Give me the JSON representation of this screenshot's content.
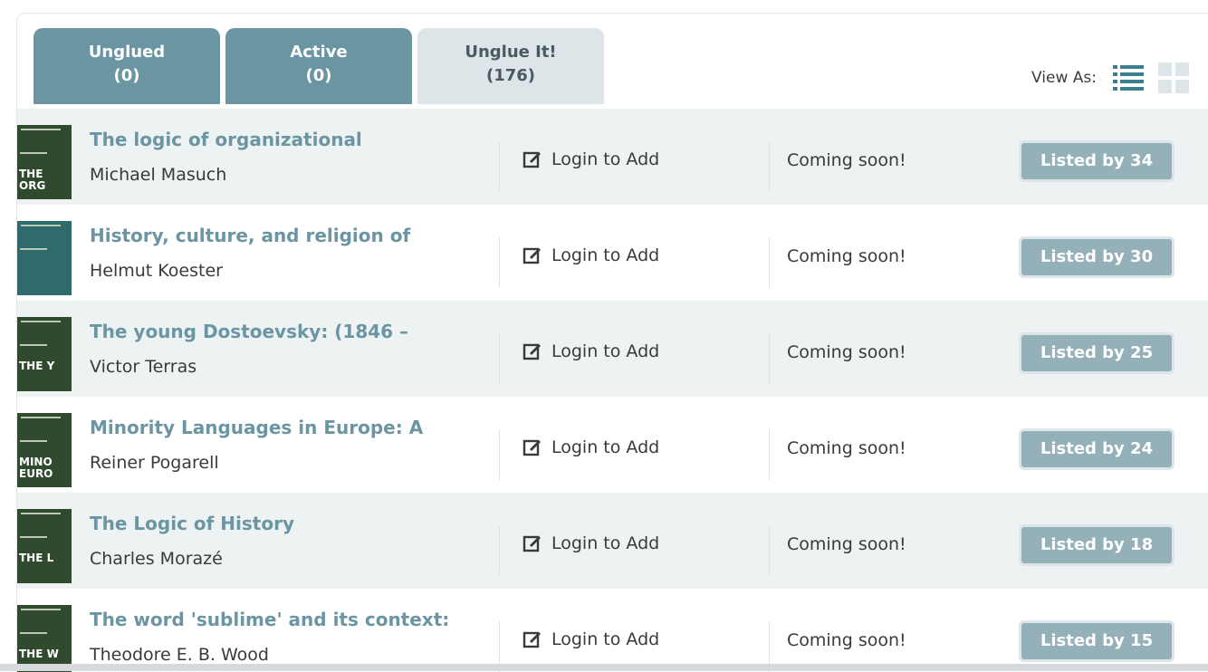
{
  "tabs": [
    {
      "line1": "Unglued",
      "line2": "(0)"
    },
    {
      "line1": "Active",
      "line2": "(0)"
    },
    {
      "line1": "Unglue It!",
      "line2": "(176)"
    }
  ],
  "view_as": {
    "label": "View As:"
  },
  "rows": [
    {
      "title": "The logic of organizational",
      "author": "Michael Masuch",
      "action": "Login to Add",
      "status": "Coming soon!",
      "listed": "Listed by 34",
      "cover_text": "THE\nORG"
    },
    {
      "title": "History, culture, and religion of",
      "author": "Helmut Koester",
      "action": "Login to Add",
      "status": "Coming soon!",
      "listed": "Listed by 30",
      "cover_text": ""
    },
    {
      "title": "The young Dostoevsky: (1846 –",
      "author": "Victor Terras",
      "action": "Login to Add",
      "status": "Coming soon!",
      "listed": "Listed by 25",
      "cover_text": "THE Y"
    },
    {
      "title": "Minority Languages in Europe: A",
      "author": "Reiner Pogarell",
      "action": "Login to Add",
      "status": "Coming soon!",
      "listed": "Listed by 24",
      "cover_text": "MINO\nEURO"
    },
    {
      "title": "The Logic of History",
      "author": "Charles Morazé",
      "action": "Login to Add",
      "status": "Coming soon!",
      "listed": "Listed by 18",
      "cover_text": "THE L"
    },
    {
      "title": "The word 'sublime' and its context:",
      "author": "Theodore E. B. Wood",
      "action": "Login to Add",
      "status": "Coming soon!",
      "listed": "Listed by 15",
      "cover_text": "THE W"
    }
  ],
  "colors": {
    "tab_dark": "#6c95a3",
    "tab_light": "#dde5e8",
    "title": "#6c95a3",
    "button": "#94b0b9",
    "row_shade": "#edf2f3"
  },
  "icons": {
    "view_list": "list-view-icon",
    "view_grid": "grid-view-icon",
    "login": "edit-icon"
  }
}
